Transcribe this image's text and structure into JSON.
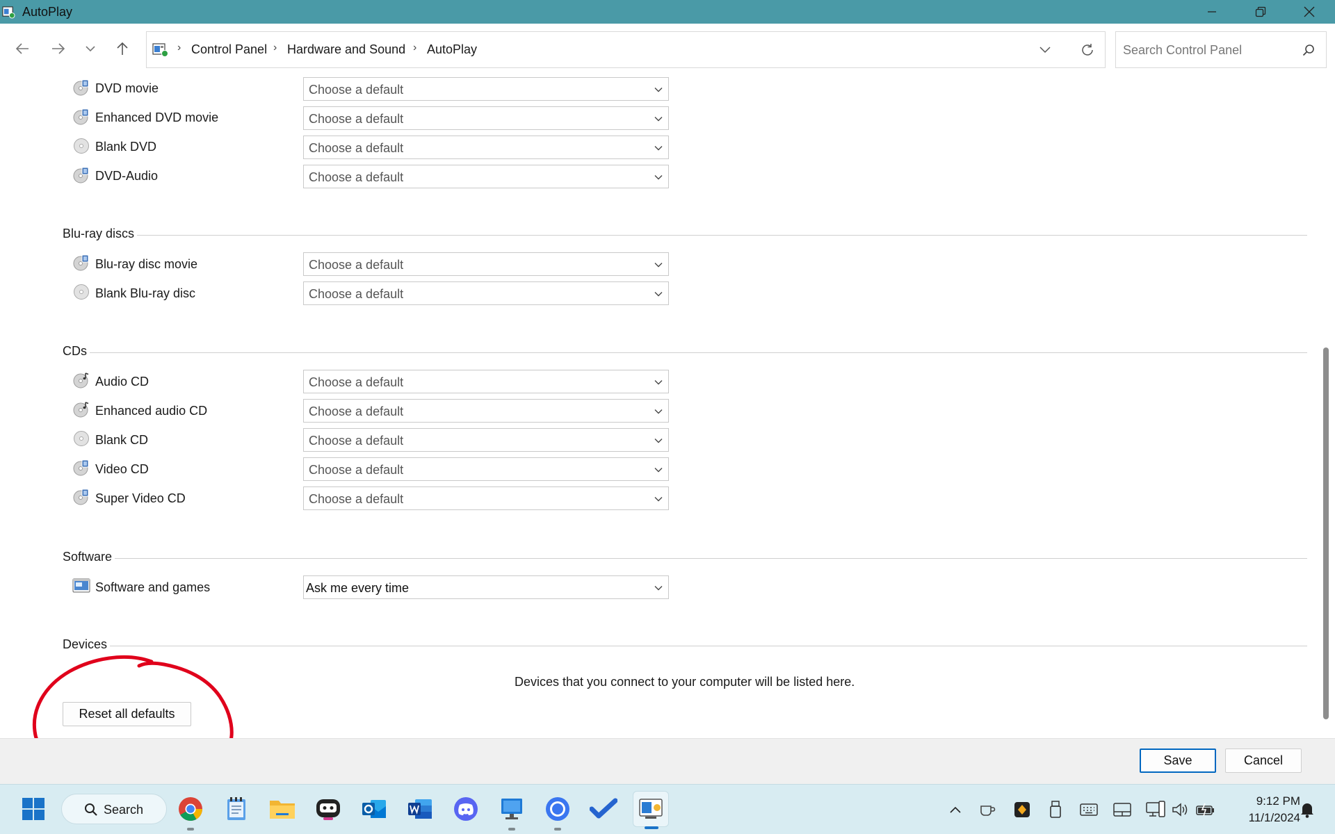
{
  "window": {
    "title": "AutoPlay"
  },
  "breadcrumb": {
    "items": [
      "Control Panel",
      "Hardware and Sound",
      "AutoPlay"
    ]
  },
  "search": {
    "placeholder": "Search Control Panel"
  },
  "groups": {
    "dvds": {
      "items": [
        {
          "label": "DVD movie",
          "value": "Choose a default",
          "icon": "dvd-movie-icon"
        },
        {
          "label": "Enhanced DVD movie",
          "value": "Choose a default",
          "icon": "dvd-movie-icon"
        },
        {
          "label": "Blank DVD",
          "value": "Choose a default",
          "icon": "blank-disc-icon"
        },
        {
          "label": "DVD-Audio",
          "value": "Choose a default",
          "icon": "dvd-movie-icon"
        }
      ]
    },
    "bluray": {
      "title": "Blu-ray discs",
      "items": [
        {
          "label": "Blu-ray disc movie",
          "value": "Choose a default",
          "icon": "dvd-movie-icon"
        },
        {
          "label": "Blank Blu-ray disc",
          "value": "Choose a default",
          "icon": "blank-disc-icon"
        }
      ]
    },
    "cds": {
      "title": "CDs",
      "items": [
        {
          "label": "Audio CD",
          "value": "Choose a default",
          "icon": "audio-cd-icon"
        },
        {
          "label": "Enhanced audio CD",
          "value": "Choose a default",
          "icon": "audio-cd-icon"
        },
        {
          "label": "Blank CD",
          "value": "Choose a default",
          "icon": "blank-disc-icon"
        },
        {
          "label": "Video CD",
          "value": "Choose a default",
          "icon": "dvd-movie-icon"
        },
        {
          "label": "Super Video CD",
          "value": "Choose a default",
          "icon": "dvd-movie-icon"
        }
      ]
    },
    "software": {
      "title": "Software",
      "items": [
        {
          "label": "Software and games",
          "value": "Ask me every time",
          "icon": "software-icon"
        }
      ]
    },
    "devices": {
      "title": "Devices",
      "message": "Devices that you connect to your computer will be listed here."
    }
  },
  "buttons": {
    "reset": "Reset all defaults",
    "save": "Save",
    "cancel": "Cancel"
  },
  "taskbar": {
    "search_label": "Search",
    "time": "9:12 PM",
    "date": "11/1/2024"
  },
  "colors": {
    "titlebar": "#4a9aa7",
    "annotation": "#e0001b",
    "primary_border": "#0067c0",
    "taskbar": "#d8ecf2"
  }
}
